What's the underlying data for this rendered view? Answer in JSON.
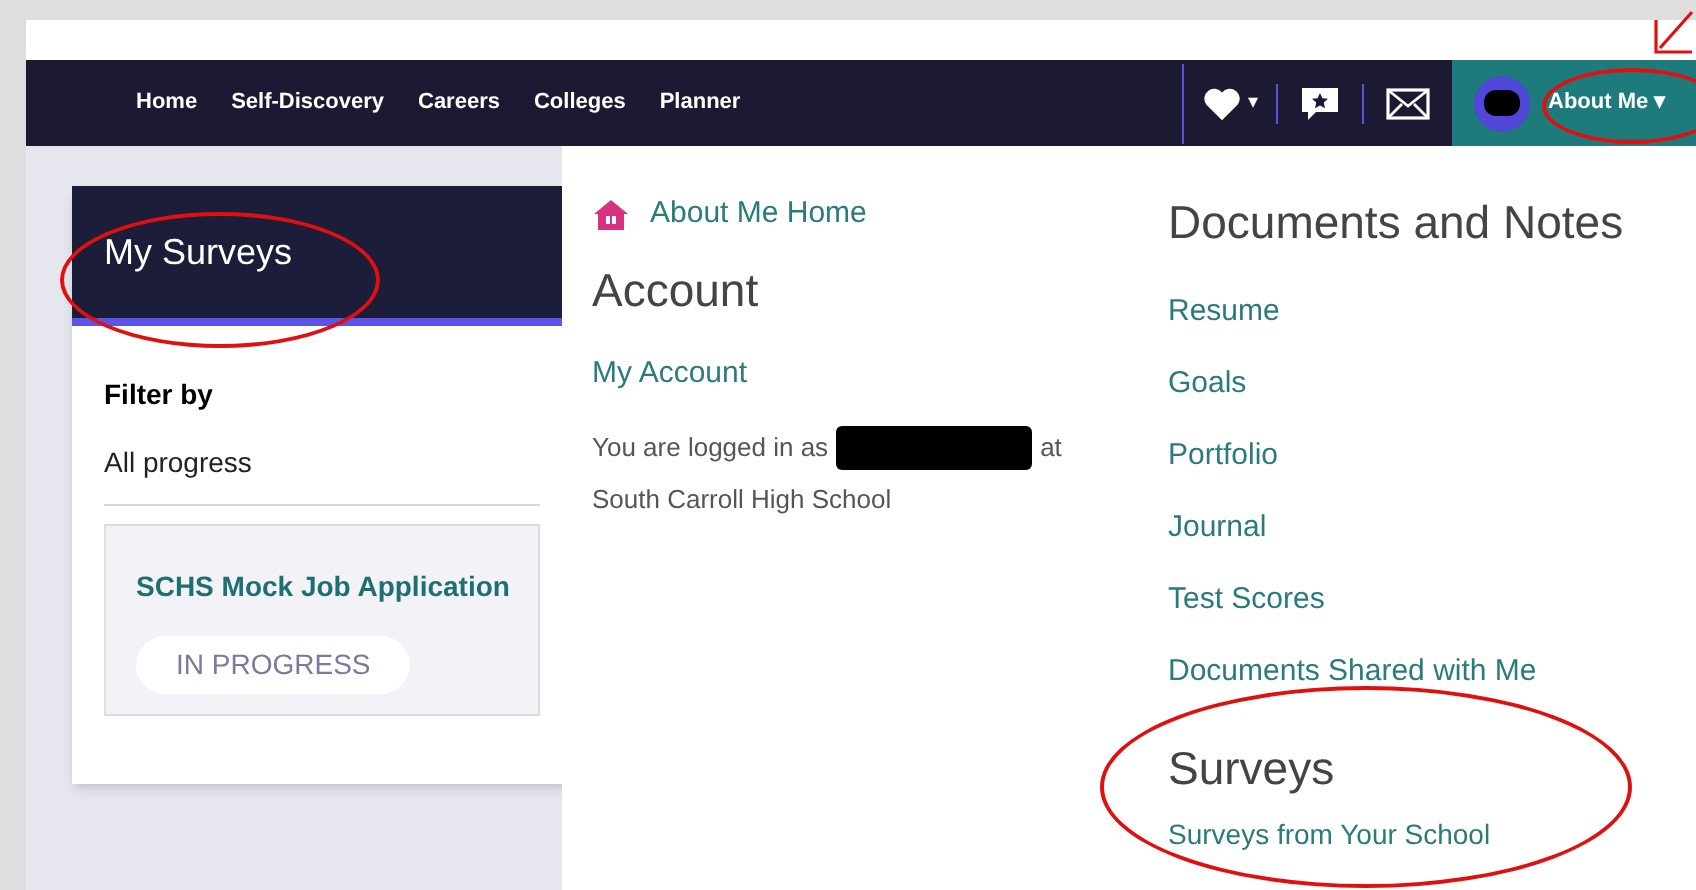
{
  "navbar": {
    "links": [
      {
        "label": "Home"
      },
      {
        "label": "Self-Discovery"
      },
      {
        "label": "Careers"
      },
      {
        "label": "Colleges"
      },
      {
        "label": "Planner"
      }
    ],
    "caret": "▾",
    "user_menu": {
      "label": "About Me",
      "caret": "▾"
    }
  },
  "surveys_card": {
    "title": "My Surveys",
    "filter_label": "Filter by",
    "filter_value": "All progress",
    "items": [
      {
        "title": "SCHS Mock Job Application",
        "status": "IN PROGRESS"
      }
    ]
  },
  "dropdown": {
    "home_link": "About Me Home",
    "account": {
      "heading": "Account",
      "link": "My Account",
      "logged_in_prefix": "You are logged in as",
      "logged_in_at": "at",
      "school": "South Carroll High School"
    },
    "documents": {
      "heading": "Documents and Notes",
      "links": [
        "Resume",
        "Goals",
        "Portfolio",
        "Journal",
        "Test Scores",
        "Documents Shared with Me"
      ]
    },
    "surveys": {
      "heading": "Surveys",
      "links": [
        "Surveys from Your School"
      ]
    }
  }
}
